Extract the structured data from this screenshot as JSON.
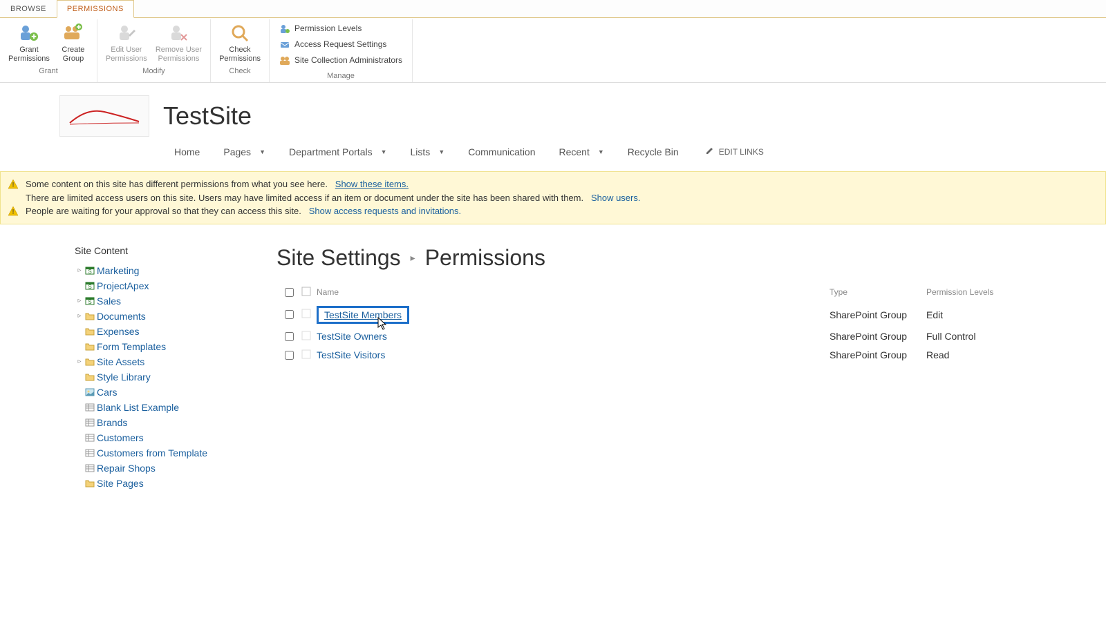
{
  "tabs": {
    "browse": "BROWSE",
    "permissions": "PERMISSIONS"
  },
  "ribbon": {
    "grant": {
      "label": "Grant",
      "grant_permissions": "Grant\nPermissions",
      "create_group": "Create\nGroup"
    },
    "modify": {
      "label": "Modify",
      "edit_user": "Edit User\nPermissions",
      "remove_user": "Remove User\nPermissions"
    },
    "check": {
      "label": "Check",
      "check_permissions": "Check\nPermissions"
    },
    "manage": {
      "label": "Manage",
      "permission_levels": "Permission Levels",
      "access_request": "Access Request Settings",
      "site_collection": "Site Collection Administrators"
    }
  },
  "site": {
    "title": "TestSite",
    "nav": {
      "home": "Home",
      "pages": "Pages",
      "department": "Department Portals",
      "lists": "Lists",
      "communication": "Communication",
      "recent": "Recent",
      "recycle": "Recycle Bin",
      "edit_links": "EDIT LINKS"
    }
  },
  "notif": {
    "line1a": "Some content on this site has different permissions from what you see here.",
    "line1b": "Show these items.",
    "line2a": "There are limited access users on this site. Users may have limited access if an item or document under the site has been shared with them.",
    "line2b": "Show users.",
    "line3a": "People are waiting for your approval so that they can access this site.",
    "line3b": "Show access requests and invitations."
  },
  "leftnav": {
    "header": "Site Content",
    "items": [
      {
        "label": "Marketing",
        "icon": "site",
        "expand": true
      },
      {
        "label": "ProjectApex",
        "icon": "site",
        "expand": false
      },
      {
        "label": "Sales",
        "icon": "site",
        "expand": true
      },
      {
        "label": "Documents",
        "icon": "lib",
        "expand": true
      },
      {
        "label": "Expenses",
        "icon": "lib",
        "expand": false
      },
      {
        "label": "Form Templates",
        "icon": "lib",
        "expand": false
      },
      {
        "label": "Site Assets",
        "icon": "lib",
        "expand": true
      },
      {
        "label": "Style Library",
        "icon": "lib",
        "expand": false
      },
      {
        "label": "Cars",
        "icon": "piclib",
        "expand": false
      },
      {
        "label": "Blank List Example",
        "icon": "list",
        "expand": false
      },
      {
        "label": "Brands",
        "icon": "list",
        "expand": false
      },
      {
        "label": "Customers",
        "icon": "list",
        "expand": false
      },
      {
        "label": "Customers from Template",
        "icon": "list",
        "expand": false
      },
      {
        "label": "Repair Shops",
        "icon": "list",
        "expand": false
      },
      {
        "label": "Site Pages",
        "icon": "lib",
        "expand": false
      }
    ]
  },
  "breadcrumb": {
    "settings": "Site Settings",
    "page": "Permissions"
  },
  "table": {
    "headers": {
      "name": "Name",
      "type": "Type",
      "levels": "Permission Levels"
    },
    "rows": [
      {
        "name": "TestSite Members",
        "type": "SharePoint Group",
        "level": "Edit",
        "highlight": true
      },
      {
        "name": "TestSite Owners",
        "type": "SharePoint Group",
        "level": "Full Control",
        "highlight": false
      },
      {
        "name": "TestSite Visitors",
        "type": "SharePoint Group",
        "level": "Read",
        "highlight": false
      }
    ]
  }
}
